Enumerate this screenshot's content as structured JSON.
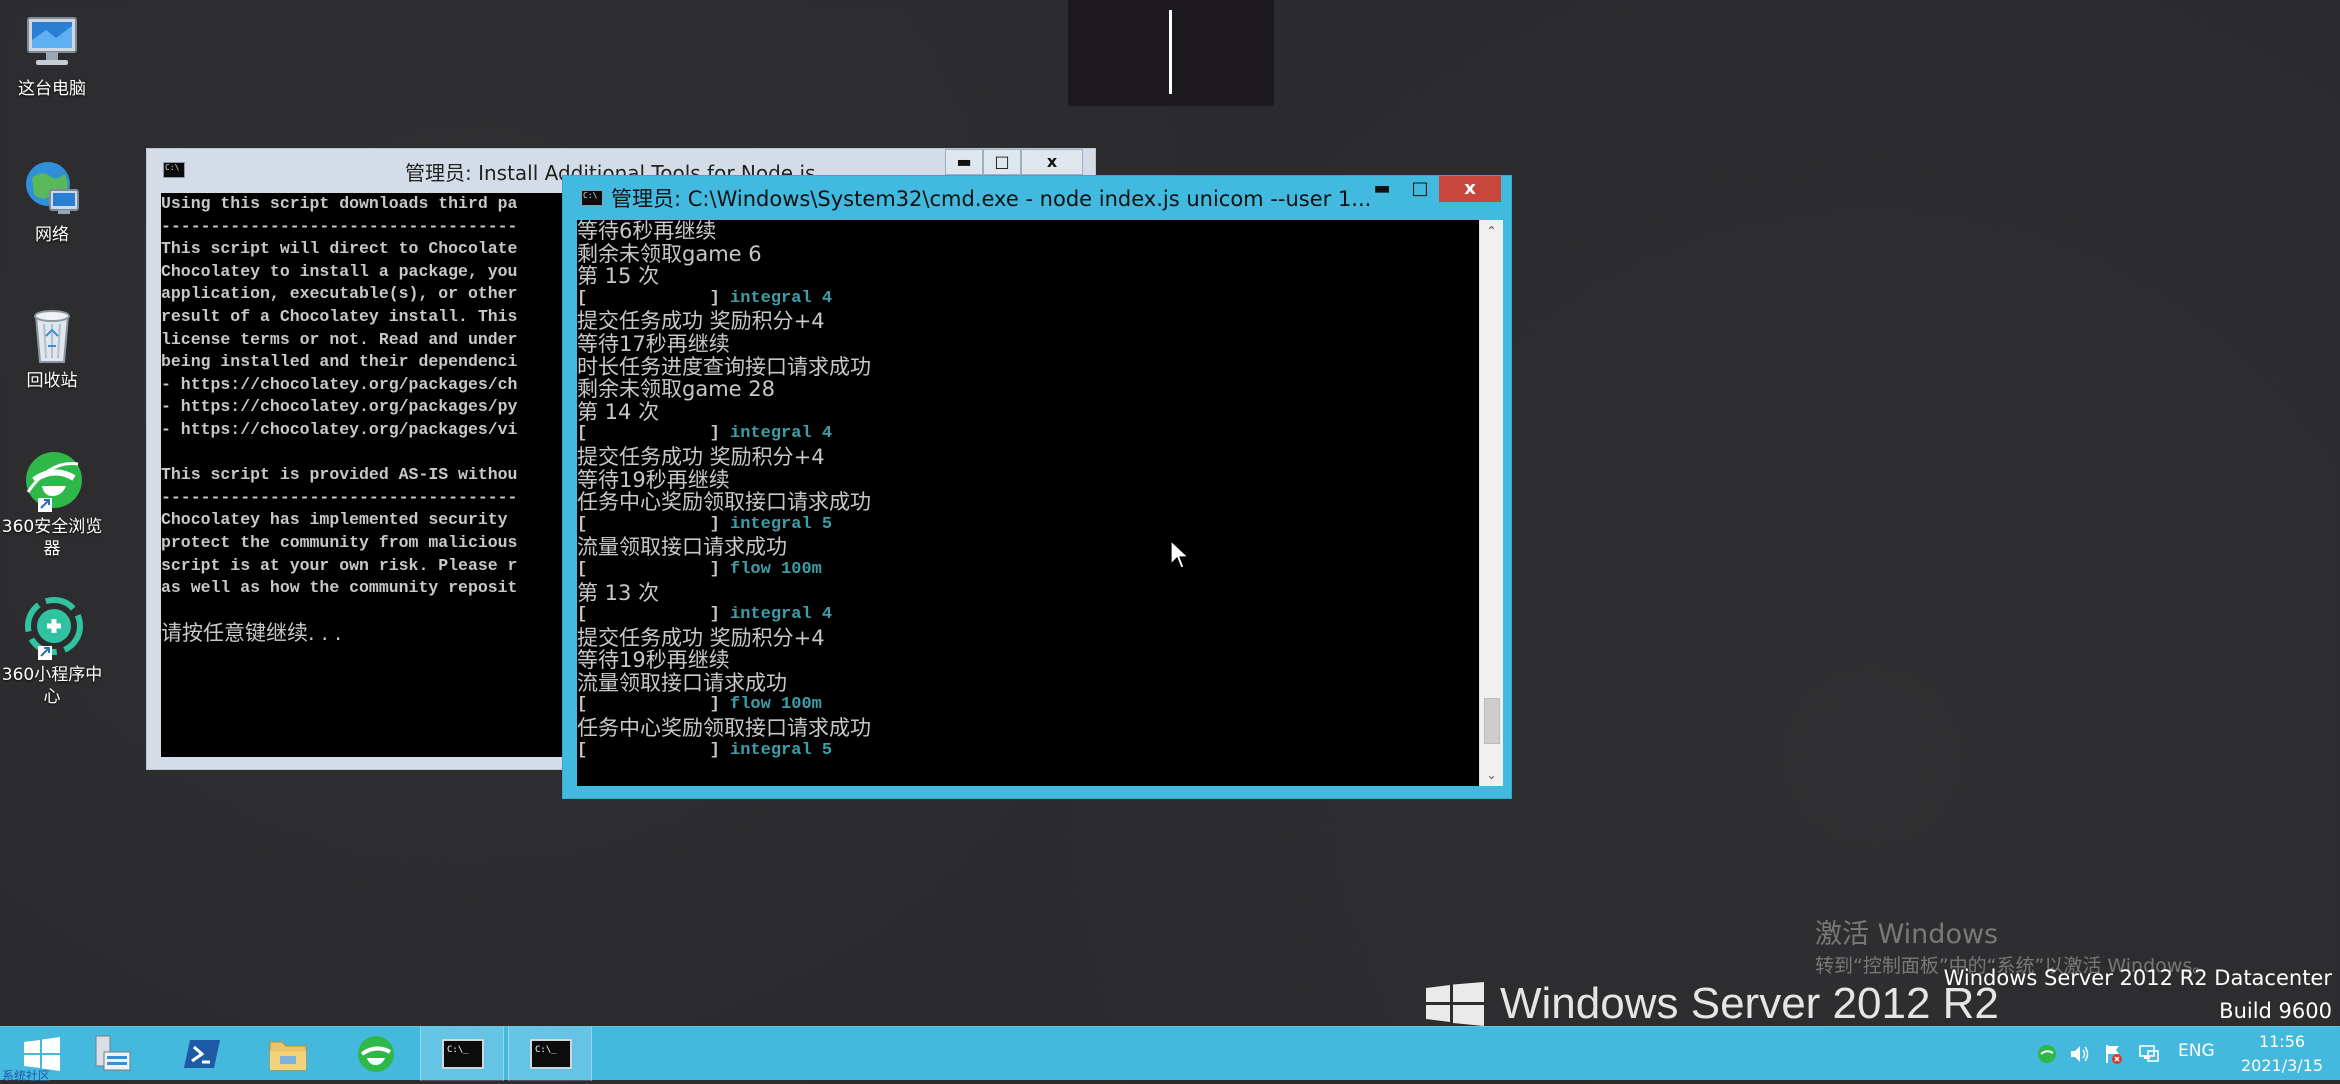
{
  "desktop": {
    "icons": [
      {
        "label": "这台电脑",
        "icon": "this-pc-icon"
      },
      {
        "label": "网络",
        "icon": "network-icon"
      },
      {
        "label": "回收站",
        "icon": "recycle-bin-icon"
      },
      {
        "label_line1": "360安全浏览",
        "label_line2": "器",
        "icon": "360-browser-icon"
      },
      {
        "label_line1": "360小程序中",
        "label_line2": "心",
        "icon": "360-miniapp-icon"
      }
    ]
  },
  "back_window": {
    "title": "管理员:  Install Additional Tools for Node.js",
    "controls": {
      "minimize": "▬",
      "maximize": "□",
      "close": "x"
    },
    "lines": [
      "Using this script downloads third pa",
      "------------------------------------",
      "This script will direct to Chocolate",
      "Chocolatey to install a package, you",
      "application, executable(s), or other",
      "result of a Chocolatey install. This",
      "license terms or not. Read and under",
      "being installed and their dependenci",
      "- https://chocolatey.org/packages/ch",
      "- https://chocolatey.org/packages/py",
      "- https://chocolatey.org/packages/vi",
      "",
      "This script is provided AS-IS withou",
      "------------------------------------",
      "Chocolatey has implemented security ",
      "protect the community from malicious",
      "script is at your own risk. Please r",
      "as well as how the community reposit",
      "",
      "请按任意键继续. . ."
    ]
  },
  "front_window": {
    "title": "管理员: C:\\Windows\\System32\\cmd.exe - node  index.js unicom --user 1...",
    "controls": {
      "minimize": "▬",
      "maximize": "□",
      "close": "x"
    },
    "lines": [
      {
        "text": "等待6秒再继续",
        "accent": ""
      },
      {
        "text": "剩余未领取game 6",
        "accent": ""
      },
      {
        "text": "第 15 次",
        "accent": ""
      },
      {
        "text": "[            ] ",
        "accent": "integral 4"
      },
      {
        "text": "提交任务成功 奖励积分+4",
        "accent": ""
      },
      {
        "text": "等待17秒再继续",
        "accent": ""
      },
      {
        "text": "时长任务进度查询接口请求成功",
        "accent": ""
      },
      {
        "text": "剩余未领取game 28",
        "accent": ""
      },
      {
        "text": "第 14 次",
        "accent": ""
      },
      {
        "text": "[            ] ",
        "accent": "integral 4"
      },
      {
        "text": "提交任务成功 奖励积分+4",
        "accent": ""
      },
      {
        "text": "等待19秒再继续",
        "accent": ""
      },
      {
        "text": "任务中心奖励领取接口请求成功",
        "accent": ""
      },
      {
        "text": "[            ] ",
        "accent": "integral 5"
      },
      {
        "text": "流量领取接口请求成功",
        "accent": ""
      },
      {
        "text": "[            ] ",
        "accent": "flow 100m"
      },
      {
        "text": "第 13 次",
        "accent": ""
      },
      {
        "text": "[            ] ",
        "accent": "integral 4"
      },
      {
        "text": "提交任务成功 奖励积分+4",
        "accent": ""
      },
      {
        "text": "等待19秒再继续",
        "accent": ""
      },
      {
        "text": "流量领取接口请求成功",
        "accent": ""
      },
      {
        "text": "[            ] ",
        "accent": "flow 100m"
      },
      {
        "text": "任务中心奖励领取接口请求成功",
        "accent": ""
      },
      {
        "text": "[            ] ",
        "accent": "integral 5"
      }
    ],
    "scroll": {
      "up": "⌃",
      "down": "⌄"
    }
  },
  "watermark": {
    "activate_title": "激活 Windows",
    "activate_sub": "转到“控制面板”中的“系统”以激活 Windows。",
    "edition": "Windows Server 2012 R2 Datacenter",
    "build": "Build 9600",
    "brand": "Windows Server 2012 R2"
  },
  "taskbar": {
    "start_caption": "系统社区",
    "lang": "ENG",
    "time": "11:56",
    "date": "2021/3/15"
  },
  "colors": {
    "taskbar": "#44b8dd",
    "active_window_frame": "#42b9de",
    "close_button": "#c9463d",
    "console_accent": "#3a9fa8"
  }
}
